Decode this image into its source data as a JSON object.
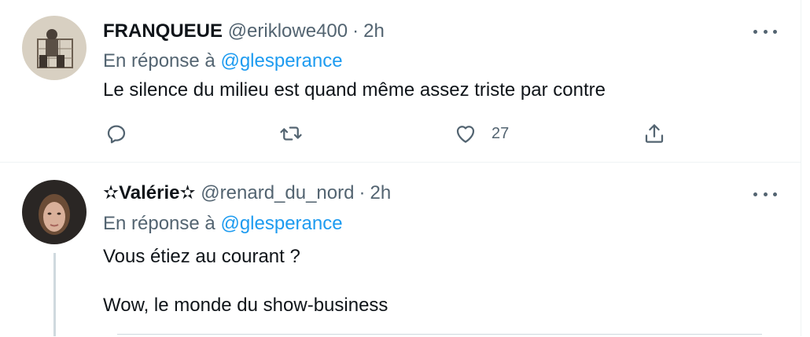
{
  "tweets": [
    {
      "name": "FRANQUEUE",
      "handle": "@eriklowe400",
      "dot": "·",
      "time": "2h",
      "reply_prefix": "En réponse à",
      "reply_mention": "@glesperance",
      "text": "Le silence du milieu est quand même assez triste par contre",
      "likes": "27"
    },
    {
      "name": "✫Valérie✫",
      "handle": "@renard_du_nord",
      "dot": "·",
      "time": "2h",
      "reply_prefix": "En réponse à",
      "reply_mention": "@glesperance",
      "text_line1": "Vous étiez au courant ?",
      "text_line2": "Wow, le monde du show-business"
    }
  ],
  "icons": {
    "reply": "reply-icon",
    "retweet": "retweet-icon",
    "like": "like-icon",
    "share": "share-icon",
    "more": "more-icon"
  },
  "colors": {
    "link": "#1d9bf0",
    "secondary_text": "#536471",
    "border": "#eff3f4"
  }
}
